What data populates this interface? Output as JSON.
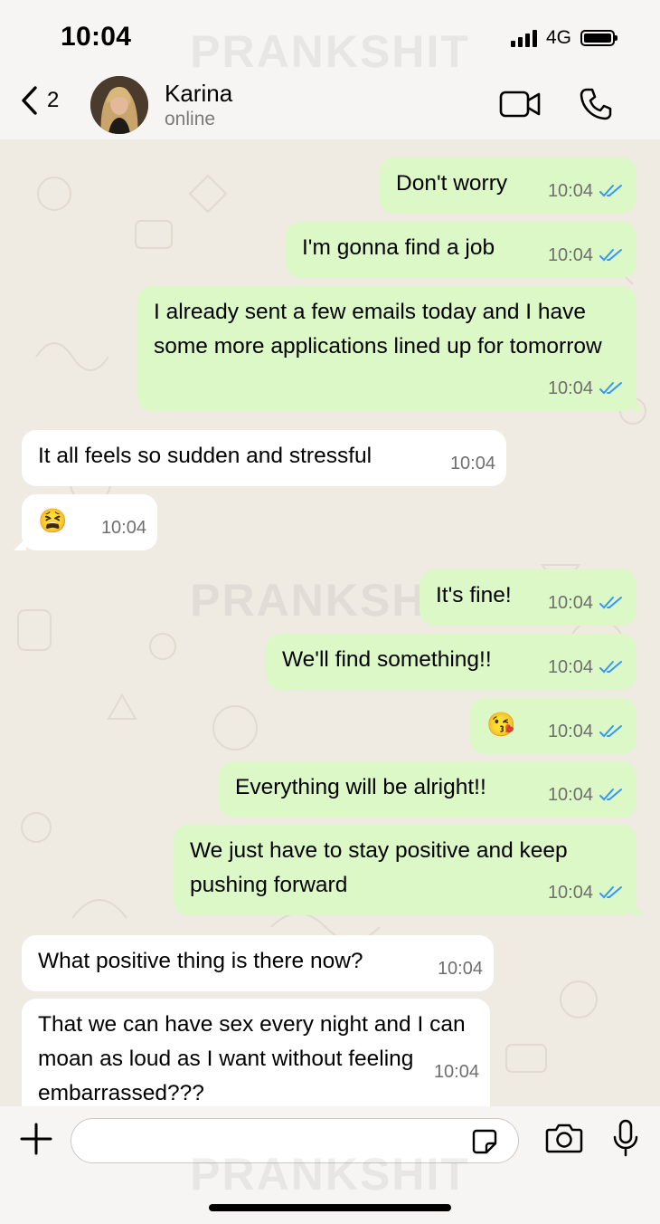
{
  "status_bar": {
    "time": "10:04",
    "network": "4G"
  },
  "watermark": "PRANKSHIT",
  "header": {
    "back_count": "2",
    "contact_name": "Karina",
    "contact_status": "online"
  },
  "messages": [
    {
      "dir": "out",
      "text": "Don't worry",
      "time": "10:04"
    },
    {
      "dir": "out",
      "text": "I'm gonna find a job",
      "time": "10:04"
    },
    {
      "dir": "out",
      "text": "I already sent a few emails today and I have some more applications lined up for tomorrow",
      "time": "10:04"
    },
    {
      "dir": "in",
      "text": "It all feels so sudden and stressful",
      "time": "10:04"
    },
    {
      "dir": "in",
      "text": "😫",
      "time": "10:04"
    },
    {
      "dir": "out",
      "text": "It's fine!",
      "time": "10:04"
    },
    {
      "dir": "out",
      "text": "We'll find something!!",
      "time": "10:04"
    },
    {
      "dir": "out",
      "text": "😘",
      "time": "10:04"
    },
    {
      "dir": "out",
      "text": "Everything will be alright!!",
      "time": "10:04"
    },
    {
      "dir": "out",
      "text": "We just have to stay positive and keep pushing forward",
      "time": "10:04"
    },
    {
      "dir": "in",
      "text": "What positive thing is there now?",
      "time": "10:04"
    },
    {
      "dir": "in",
      "text": "That we can have sex every night and I can moan as loud as I want without feeling embarrassed???",
      "time": "10:04"
    }
  ],
  "colors": {
    "outgoing": "#dbf8c6",
    "incoming": "#ffffff",
    "read_ticks": "#3497f9",
    "background": "#efeae2"
  },
  "input": {
    "placeholder": ""
  }
}
